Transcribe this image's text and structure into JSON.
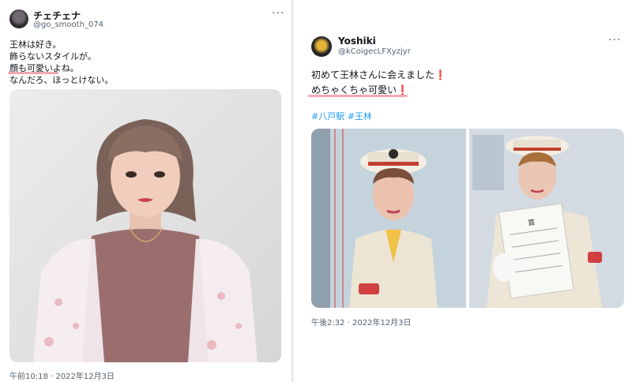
{
  "tweet_left": {
    "author_name": "チェチェナ",
    "author_handle": "@go_smooth_074",
    "more_icon": "more-icon",
    "lines": [
      "王林は好き。",
      "飾らないスタイルが。",
      "顔も可愛いよね。",
      "なんだろ、ほっとけない。"
    ],
    "timestamp": "午前10:18 · 2022年12月3日"
  },
  "tweet_right": {
    "author_name": "Yoshiki",
    "author_handle": "@kCoigecLFXyzjyr",
    "more_icon": "more-icon",
    "lines": [
      "初めて王林さんに会えました",
      "めちゃくちゃ可愛い"
    ],
    "exclamation_mark": "❗",
    "hashtags": [
      "#八戸駅",
      "#王林"
    ],
    "certificate_title": "賞",
    "timestamp": "午後2:32 · 2022年12月3日"
  },
  "colors": {
    "underline": "#f4a6b3",
    "hashtag": "#1d9bf0",
    "exclamation": "#e0245e",
    "secondary_text": "#536471"
  }
}
